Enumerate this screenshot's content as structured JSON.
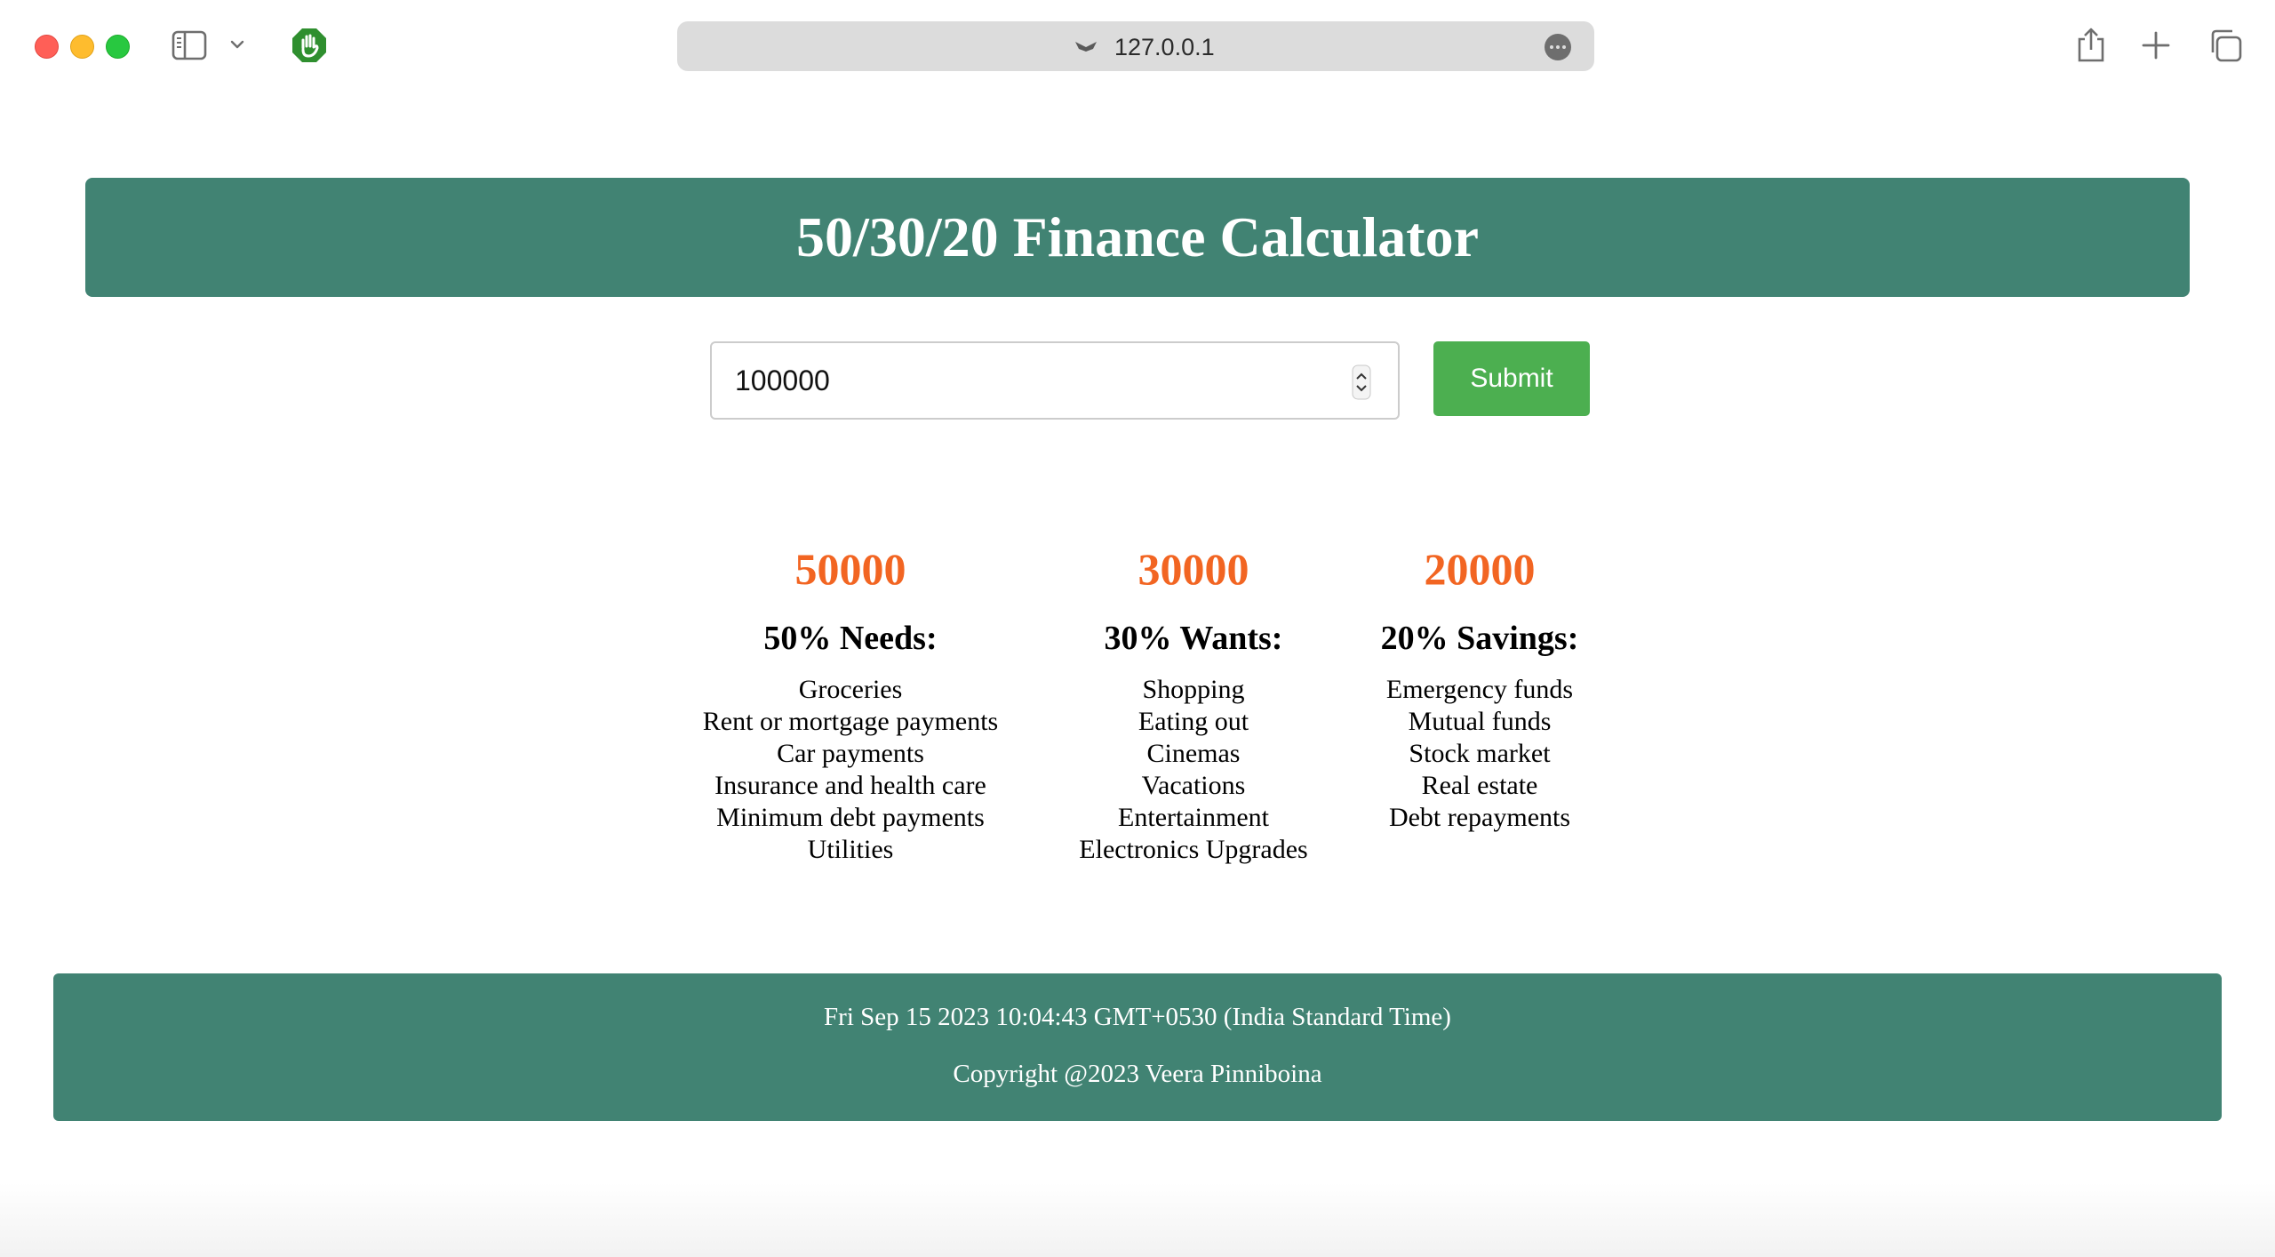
{
  "browser": {
    "url": "127.0.0.1",
    "icons": {
      "sidebar": "sidebar-icon",
      "chevron": "chevron-down-icon",
      "extension": "hand-stop-icon",
      "site": "site-favicon-icon",
      "more": "ellipsis-icon",
      "share": "share-icon",
      "new_tab": "plus-icon",
      "tabs": "tab-overview-icon"
    }
  },
  "page": {
    "title": "50/30/20 Finance Calculator",
    "input_value": "100000",
    "submit_label": "Submit",
    "columns": [
      {
        "amount": "50000",
        "heading": "50% Needs:",
        "items": [
          "Groceries",
          "Rent or mortgage payments",
          "Car payments",
          "Insurance and health care",
          "Minimum debt payments",
          "Utilities"
        ]
      },
      {
        "amount": "30000",
        "heading": "30% Wants:",
        "items": [
          "Shopping",
          "Eating out",
          "Cinemas",
          "Vacations",
          "Entertainment",
          "Electronics Upgrades"
        ]
      },
      {
        "amount": "20000",
        "heading": "20% Savings:",
        "items": [
          "Emergency funds",
          "Mutual funds",
          "Stock market",
          "Real estate",
          "Debt repayments"
        ]
      }
    ],
    "footer": {
      "date": "Fri Sep 15 2023 10:04:43 GMT+0530 (India Standard Time)",
      "copyright": "Copyright @2023 Veera Pinniboina"
    }
  },
  "colors": {
    "header_bg": "#418373",
    "submit_bg": "#4caf50",
    "amount_text": "#f26522"
  }
}
